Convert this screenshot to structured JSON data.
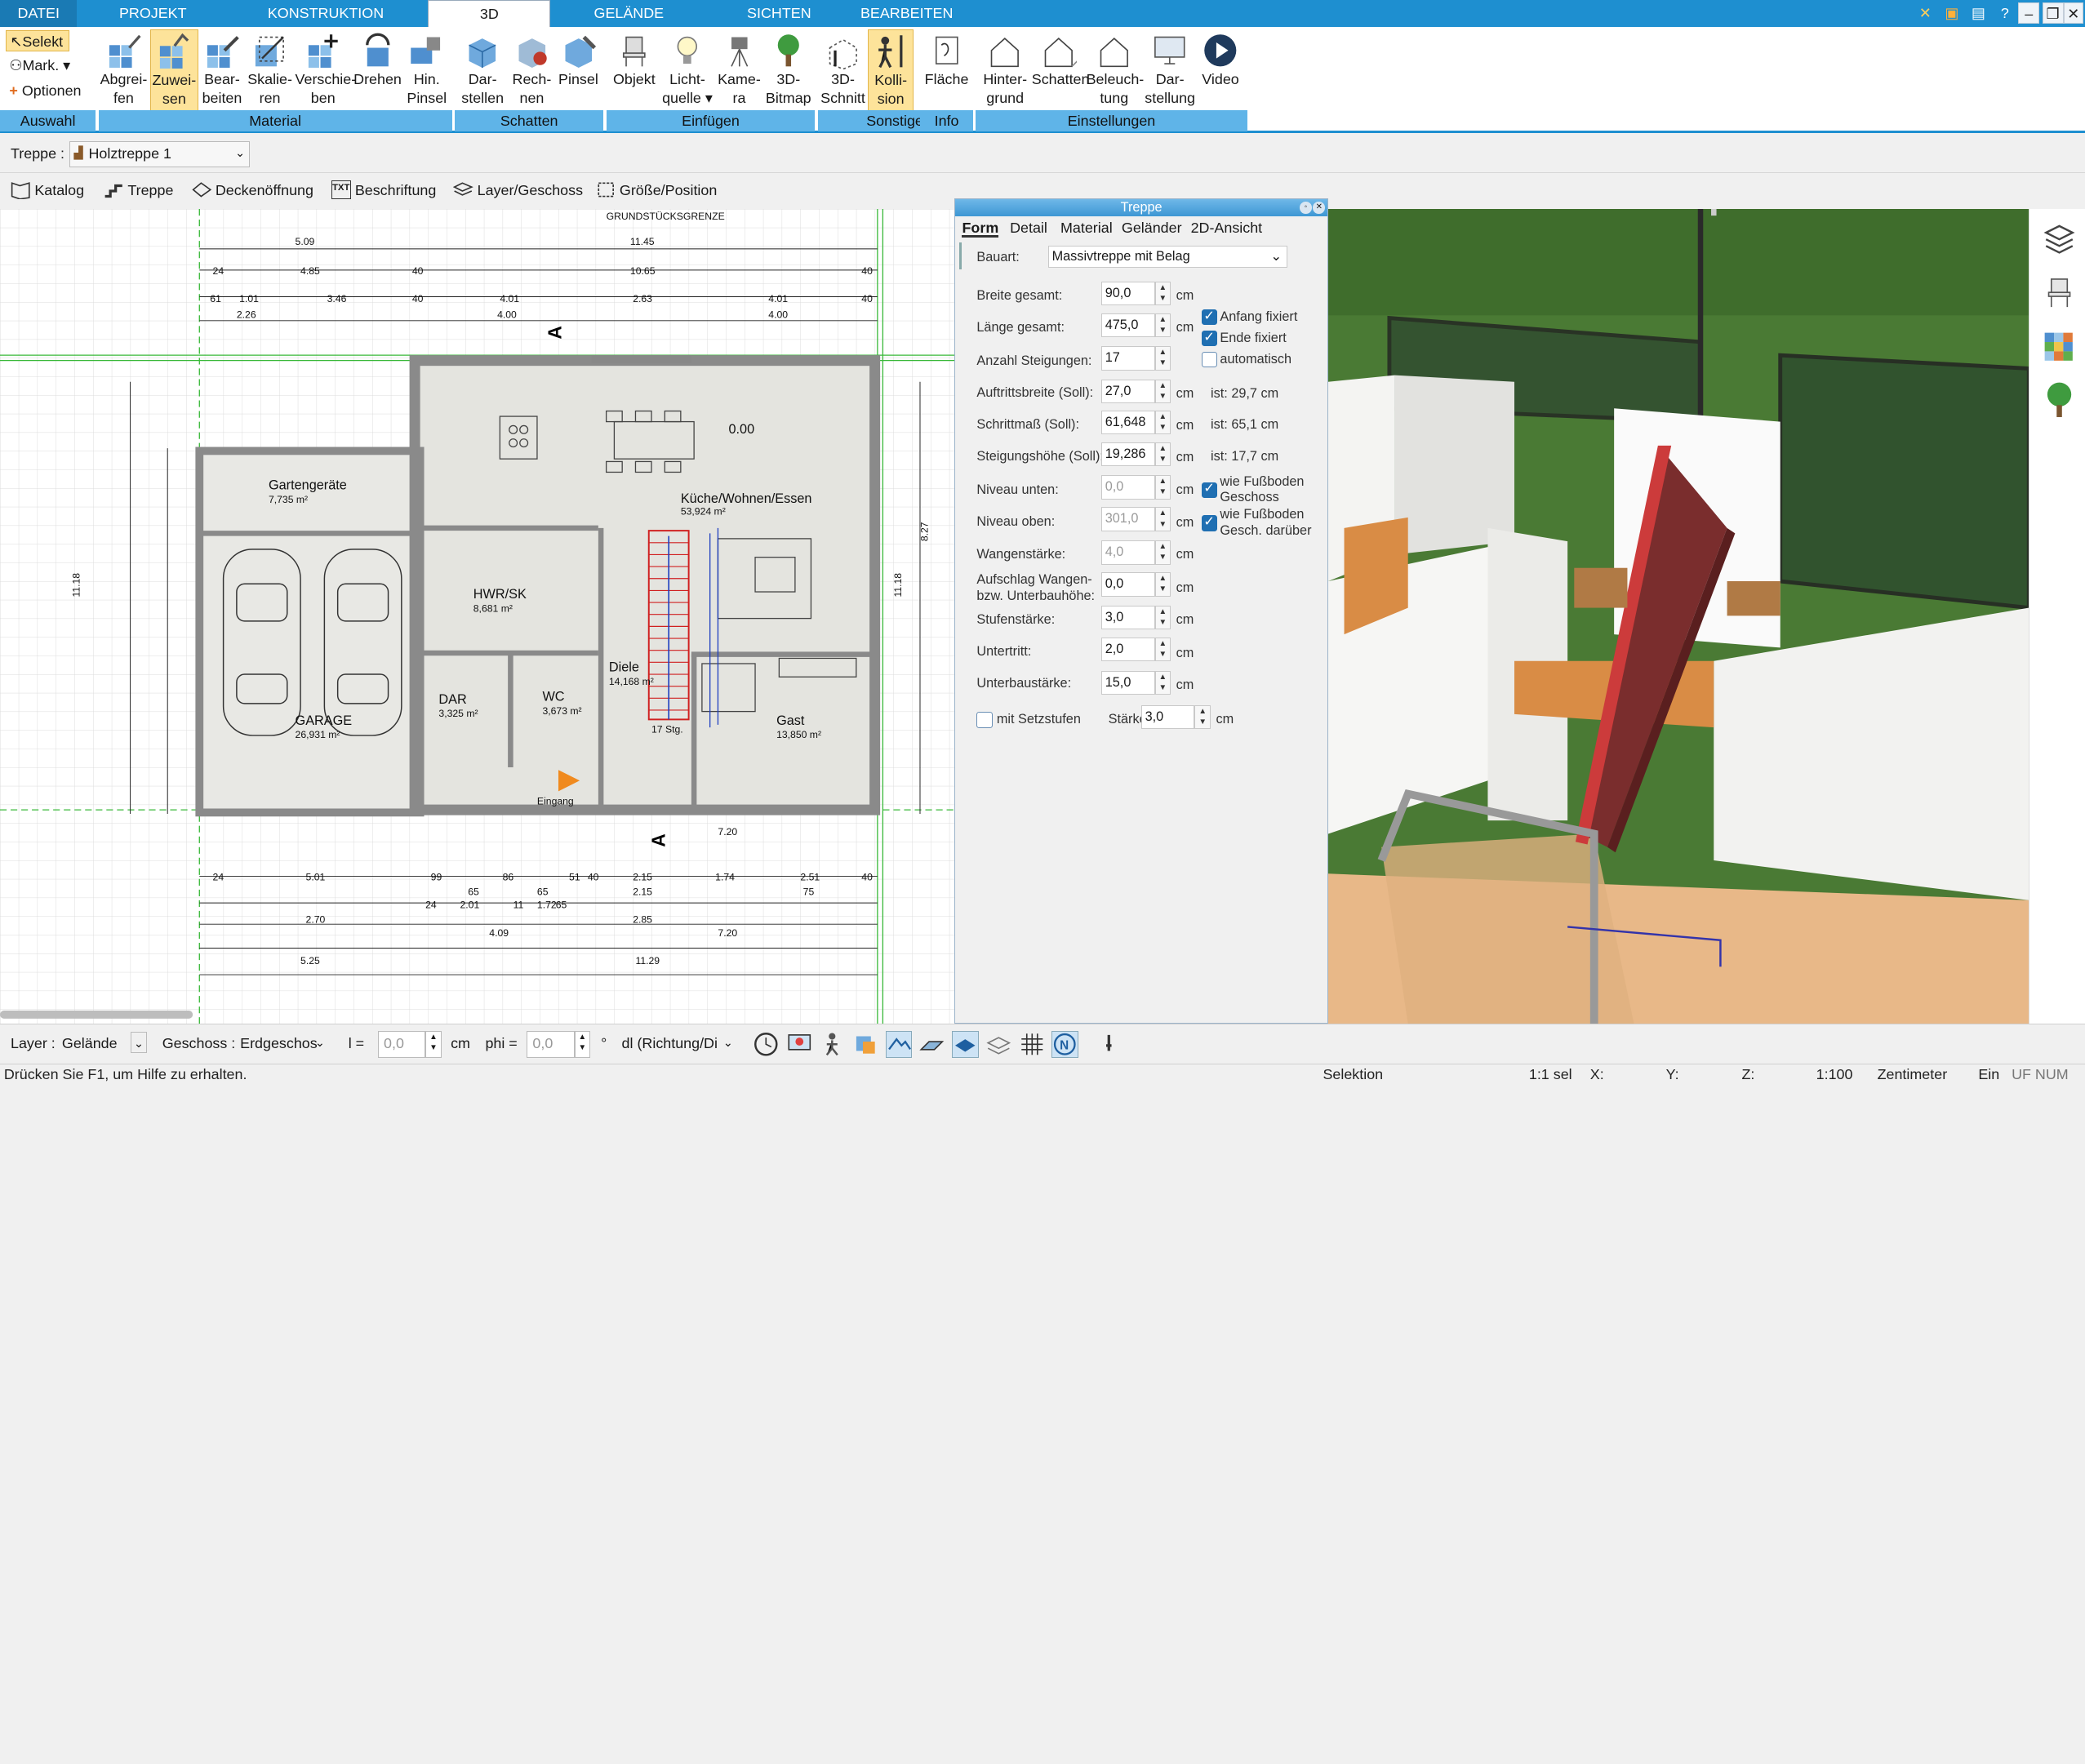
{
  "tabs": [
    "DATEI",
    "PROJEKT",
    "KONSTRUKTION",
    "3D",
    "GELÄNDE",
    "SICHTEN",
    "BEARBEITEN"
  ],
  "ribbon": {
    "auswahl": {
      "selekt": "Selekt",
      "mark": "Mark. ▾",
      "optionen": "Optionen",
      "group": "Auswahl"
    },
    "material": {
      "buttons": [
        "Abgrei-\nfen",
        "Zuwei-\nsen",
        "Bear-\nbeiten",
        "Skalie-\nren",
        "Verschie-\nben",
        "Drehen",
        "Hin.\nPinsel"
      ],
      "group": "Material"
    },
    "schatten": {
      "buttons": [
        "Dar-\nstellen",
        "Rech-\nnen",
        "Pinsel"
      ],
      "group": "Schatten"
    },
    "einfuegen": {
      "buttons": [
        "Objekt",
        "Licht-\nquelle ▾",
        "Kame-\nra",
        "3D-\nBitmap"
      ],
      "group": "Einfügen"
    },
    "sonstige": {
      "buttons": [
        "3D-\nSchnitt",
        "Kolli-\nsion"
      ],
      "group": "Sonstige"
    },
    "info": {
      "buttons": [
        "Fläche"
      ],
      "group": "Info"
    },
    "einstellungen": {
      "buttons": [
        "Hinter-\ngrund",
        "Schatten",
        "Beleuch-\ntung",
        "Dar-\nstellung",
        "Video"
      ],
      "group": "Einstellungen"
    }
  },
  "propbar": {
    "label": "Treppe :",
    "value": "Holztreppe 1"
  },
  "toolbar2": [
    "Katalog",
    "Treppe",
    "Deckenöffnung",
    "Beschriftung",
    "Layer/Geschoss",
    "Größe/Position"
  ],
  "plan": {
    "top_label": "GRUNDSTÜCKSGRENZE",
    "rooms": [
      {
        "name": "Gartengeräte",
        "area": "7,735 m²"
      },
      {
        "name": "Küche/Wohnen/Essen",
        "area": "53,924 m²"
      },
      {
        "name": "HWR/SK",
        "area": "8,681 m²"
      },
      {
        "name": "Diele",
        "area": "14,168 m²"
      },
      {
        "name": "GARAGE",
        "area": "26,931 m²"
      },
      {
        "name": "DAR",
        "area": "3,325 m²"
      },
      {
        "name": "WC",
        "area": "3,673 m²"
      },
      {
        "name": "Gast",
        "area": "13,850 m²"
      }
    ],
    "dims_top": [
      "5.09",
      "11.45",
      "24",
      "4.85",
      "40",
      "10.65",
      "40",
      "61",
      "1.01",
      "3.46",
      "40",
      "4.01",
      "2.63",
      "4.01",
      "40",
      "2.26",
      "4.00",
      "4.00"
    ],
    "dims_bottom": [
      "24",
      "5.01",
      "99",
      "65",
      "86",
      "65",
      "51",
      "40",
      "2.15",
      "1.74",
      "2.51",
      "40",
      "24",
      "2.01",
      "11",
      "1.72",
      "65",
      "2.15",
      "75",
      "2.70",
      "2.85",
      "4.09",
      "7.20",
      "5.25",
      "11.29"
    ],
    "labels": {
      "elev": "0.00",
      "entry": "Eingang",
      "steps": "17 Stg.",
      "stair_dim": "7.20",
      "wall1": "11.18",
      "wall2": "8.27",
      "wall3": "11.18"
    }
  },
  "dialog": {
    "title": "Treppe",
    "tabs": [
      "Form",
      "Detail",
      "Material",
      "Geländer",
      "2D-Ansicht"
    ],
    "bauart_label": "Bauart:",
    "bauart_value": "Massivtreppe mit Belag",
    "fields": [
      {
        "label": "Breite gesamt:",
        "value": "90,0",
        "unit": "cm"
      },
      {
        "label": "Länge gesamt:",
        "value": "475,0",
        "unit": "cm"
      },
      {
        "label": "Anzahl Steigungen:",
        "value": "17",
        "unit": ""
      },
      {
        "label": "Auftrittsbreite (Soll):",
        "value": "27,0",
        "unit": "cm",
        "ist": "ist: 29,7 cm"
      },
      {
        "label": "Schrittmaß (Soll):",
        "value": "61,648",
        "unit": "cm",
        "ist": "ist: 65,1 cm"
      },
      {
        "label": "Steigungshöhe (Soll):",
        "value": "19,286",
        "unit": "cm",
        "ist": "ist: 17,7 cm"
      },
      {
        "label": "Niveau unten:",
        "value": "0,0",
        "unit": "cm"
      },
      {
        "label": "Niveau oben:",
        "value": "301,0",
        "unit": "cm"
      },
      {
        "label": "Wangenstärke:",
        "value": "4,0",
        "unit": "cm"
      },
      {
        "label": "Aufschlag Wangen-\nbzw. Unterbauhöhe:",
        "value": "0,0",
        "unit": "cm"
      },
      {
        "label": "Stufenstärke:",
        "value": "3,0",
        "unit": "cm"
      },
      {
        "label": "Untertritt:",
        "value": "2,0",
        "unit": "cm"
      },
      {
        "label": "Unterbaustärke:",
        "value": "15,0",
        "unit": "cm"
      }
    ],
    "checks": {
      "anfang": "Anfang fixiert",
      "ende": "Ende fixiert",
      "auto": "automatisch",
      "fuss1": "wie Fußboden\nGeschoss",
      "fuss2": "wie Fußboden\nGesch. darüber"
    },
    "setzstufen": "mit Setzstufen",
    "staerke_label": "Stärke:",
    "staerke_value": "3,0",
    "staerke_unit": "cm"
  },
  "bottom": {
    "layer_label": "Layer :",
    "layer_value": "Gelände",
    "geschoss_label": "Geschoss :",
    "geschoss_value": "Erdgeschos",
    "l_label": "l =",
    "l_value": "0,0",
    "l_unit": "cm",
    "phi_label": "phi =",
    "phi_value": "0,0",
    "phi_unit": "°",
    "dl_value": "dl (Richtung/Di"
  },
  "status": {
    "help": "Drücken Sie F1, um Hilfe zu erhalten.",
    "mode": "Selektion",
    "sel": "1:1 sel",
    "x": "X:",
    "y": "Y:",
    "z": "Z:",
    "scale": "1:100",
    "unit": "Zentimeter",
    "ein": "Ein",
    "flags": "UF NUM RF"
  },
  "colors": {
    "accent": "#1e8fd0",
    "group": "#5fb4e8",
    "selected": "#fde39a",
    "grass": "#3b6b27",
    "floor": "#d9a26b",
    "stair": "#7a2d2d"
  }
}
